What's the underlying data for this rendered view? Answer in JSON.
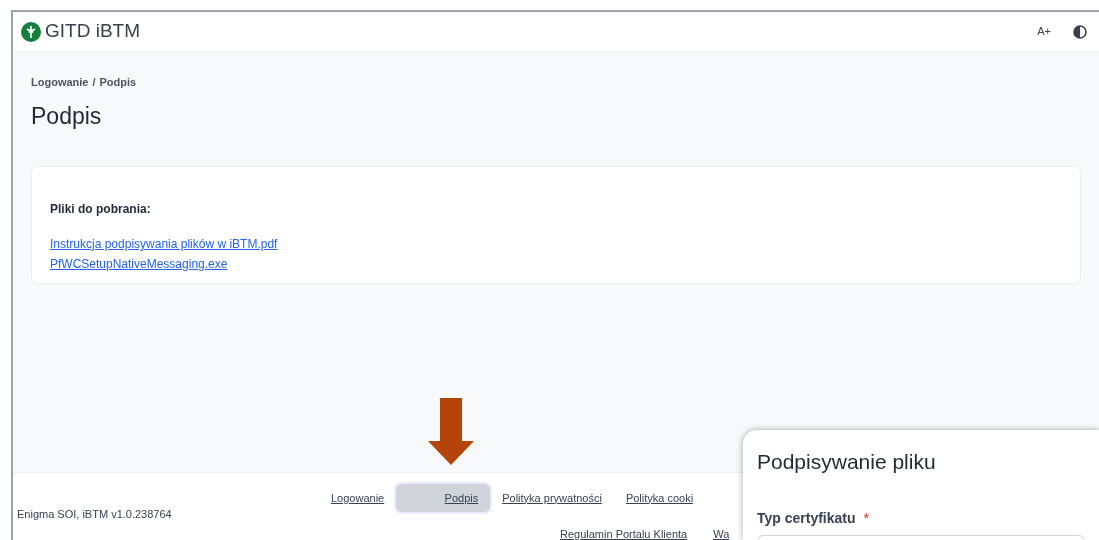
{
  "header": {
    "app_name": "GITD iBTM",
    "font_size_button": "A+"
  },
  "breadcrumb": [
    "Logowanie",
    "Podpis"
  ],
  "breadcrumb_separator": "/",
  "page_title": "Podpis",
  "downloads": {
    "heading": "Pliki do pobrania:",
    "files": [
      "Instrukcja podpisywania plików w iBTM.pdf",
      "PfWCSetupNativeMessaging.exe"
    ]
  },
  "footer": {
    "version": "Enigma SOI, iBTM v1.0.238764",
    "links_row_1": [
      {
        "label": "Logowanie",
        "selected": false
      },
      {
        "label": "Podpis",
        "selected": true
      },
      {
        "label": "Polityka prywatności",
        "selected": false
      },
      {
        "label": "Polityka cooki",
        "selected": false
      }
    ],
    "links_row_2": [
      {
        "label": "Regulamin Portalu Klienta",
        "selected": false
      },
      {
        "label": "Wa",
        "selected": false
      }
    ]
  },
  "dialog": {
    "title": "Podpisywanie pliku",
    "field_label": "Typ certyfikatu",
    "required_mark": "*"
  }
}
